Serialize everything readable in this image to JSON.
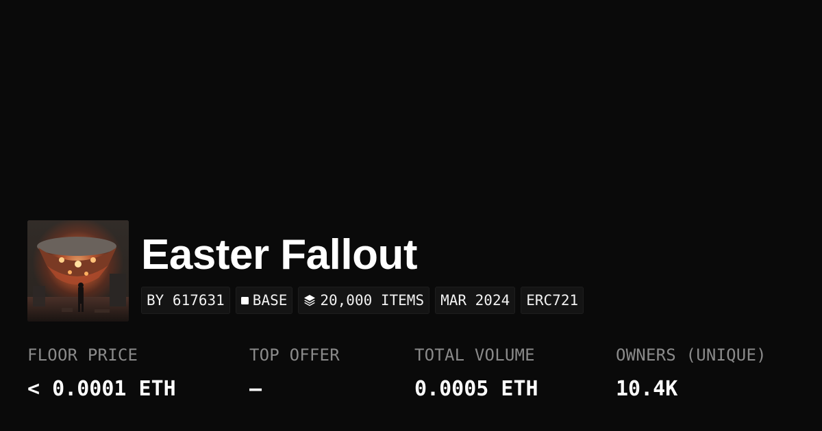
{
  "collection": {
    "name": "Easter Fallout",
    "thumbnail_icon": "collection-artwork-image"
  },
  "tags": [
    {
      "label": "BY 617631",
      "icon": null
    },
    {
      "label": "BASE",
      "icon": "chain-square-icon"
    },
    {
      "label": "20,000 ITEMS",
      "icon": "layers-icon"
    },
    {
      "label": "MAR 2024",
      "icon": null
    },
    {
      "label": "ERC721",
      "icon": null
    }
  ],
  "stats": [
    {
      "label": "FLOOR PRICE",
      "value": "< 0.0001 ETH"
    },
    {
      "label": "TOP OFFER",
      "value": "–"
    },
    {
      "label": "TOTAL VOLUME",
      "value": "0.0005 ETH"
    },
    {
      "label": "OWNERS (UNIQUE)",
      "value": "10.4K"
    }
  ],
  "colors": {
    "background": "#0a0a0a",
    "text": "#ffffff",
    "muted": "#8a8a8a",
    "tag_bg": "#141414"
  }
}
